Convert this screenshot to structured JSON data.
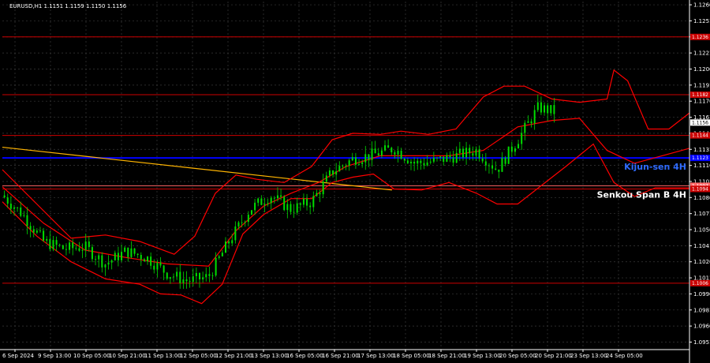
{
  "chart_data": {
    "type": "candlestick",
    "symbol_header": "EURUSD,H1  1.1151 1.1159 1.1150 1.1156",
    "x_labels": [
      "6 Sep 2024",
      "9 Sep 13:00",
      "10 Sep 05:00",
      "10 Sep 21:00",
      "11 Sep 13:00",
      "12 Sep 05:00",
      "12 Sep 21:00",
      "13 Sep 13:00",
      "16 Sep 05:00",
      "16 Sep 21:00",
      "17 Sep 13:00",
      "18 Sep 05:00",
      "18 Sep 21:00",
      "19 Sep 13:00",
      "20 Sep 05:00",
      "20 Sep 21:00",
      "23 Sep 13:00",
      "24 Sep 05:00"
    ],
    "y_ticks": [
      1.1266,
      1.1251,
      1.1236,
      1.1221,
      1.1206,
      1.1191,
      1.1176,
      1.1161,
      1.1146,
      1.1131,
      1.1116,
      1.1101,
      1.1086,
      1.1071,
      1.1056,
      1.1041,
      1.1026,
      1.1011,
      1.0996,
      1.0981,
      1.0966,
      1.0951
    ],
    "ylim": [
      1.0944,
      1.1269
    ],
    "grid": true,
    "colors": {
      "background": "#000000",
      "grid": "#3a3a3a",
      "candle": "#00dd00",
      "bollinger": "#ff0000",
      "kijun": "#0000ff",
      "senkou": "#ff6666",
      "trend": "#ffb400",
      "price_tag": "#ffffff"
    },
    "current_price": "1.1156",
    "levels": [
      {
        "price": 1.1236,
        "label": "1.1236",
        "color": "#cc0000"
      },
      {
        "price": 1.1182,
        "label": "1.1182",
        "color": "#cc0000"
      },
      {
        "price": 1.1144,
        "label": "1.1144",
        "color": "#cc0000"
      },
      {
        "price": 1.1123,
        "label": "1.1123",
        "color": "#0000ff",
        "annotation": "Kijun-sen 4H",
        "annotation_color": "#2f6bff"
      },
      {
        "price": 1.1097,
        "label": "1.1097",
        "color": "#ff6666",
        "annotation": "Senkou Span B 4H",
        "annotation_color": "#ffffff"
      },
      {
        "price": 1.1094,
        "label": "1.1094",
        "color": "#cc0000"
      },
      {
        "price": 1.1006,
        "label": "1.1006",
        "color": "#cc0000"
      }
    ],
    "trend_line": {
      "x": [
        0,
        0.567
      ],
      "y": [
        1.1133,
        1.1093
      ]
    },
    "x_range": [
      0,
      1
    ],
    "series": [
      {
        "name": "price",
        "x": [
          0,
          0.03,
          0.06,
          0.09,
          0.12,
          0.15,
          0.18,
          0.21,
          0.24,
          0.27,
          0.3,
          0.33,
          0.36,
          0.39,
          0.42,
          0.45,
          0.48,
          0.51,
          0.54,
          0.57,
          0.6,
          0.63,
          0.66,
          0.69,
          0.72,
          0.75,
          0.78,
          0.81,
          0.84,
          0.87,
          0.9,
          0.93,
          0.96,
          1.0
        ],
        "y": [
          1.1088,
          1.107,
          1.1045,
          1.1038,
          1.104,
          1.1024,
          1.1036,
          1.103,
          1.1015,
          1.1008,
          1.1012,
          1.1045,
          1.1075,
          1.1088,
          1.1075,
          1.1082,
          1.111,
          1.1122,
          1.1126,
          1.1132,
          1.1118,
          1.112,
          1.1125,
          1.113,
          1.1112,
          1.114,
          1.117,
          1.1165,
          1.1168,
          1.116,
          1.111,
          1.1115,
          1.113,
          1.1155
        ]
      },
      {
        "name": "bb_upper",
        "x": [
          0,
          0.05,
          0.1,
          0.15,
          0.2,
          0.25,
          0.28,
          0.31,
          0.34,
          0.37,
          0.41,
          0.45,
          0.48,
          0.51,
          0.55,
          0.58,
          0.62,
          0.66,
          0.7,
          0.73,
          0.76,
          0.8,
          0.84,
          0.88,
          0.89,
          0.91,
          0.94,
          0.97,
          1.0
        ],
        "y": [
          1.1112,
          1.108,
          1.1048,
          1.1051,
          1.1045,
          1.1033,
          1.105,
          1.109,
          1.1107,
          1.1103,
          1.11,
          1.1115,
          1.114,
          1.1146,
          1.1145,
          1.1148,
          1.1145,
          1.115,
          1.118,
          1.119,
          1.119,
          1.1178,
          1.1175,
          1.1178,
          1.1205,
          1.1195,
          1.115,
          1.115,
          1.1165
        ]
      },
      {
        "name": "bb_lower",
        "x": [
          0,
          0.05,
          0.1,
          0.15,
          0.2,
          0.23,
          0.26,
          0.29,
          0.32,
          0.35,
          0.38,
          0.42,
          0.45,
          0.48,
          0.51,
          0.54,
          0.57,
          0.61,
          0.65,
          0.69,
          0.72,
          0.75,
          0.78,
          0.82,
          0.86,
          0.89,
          0.92,
          0.95,
          1.0
        ],
        "y": [
          1.1082,
          1.105,
          1.1026,
          1.101,
          1.1005,
          1.0996,
          1.0995,
          1.0987,
          1.1005,
          1.1052,
          1.107,
          1.1085,
          1.1085,
          1.11,
          1.1105,
          1.1108,
          1.1094,
          1.1093,
          1.11,
          1.109,
          1.108,
          1.108,
          1.1095,
          1.1115,
          1.1136,
          1.11,
          1.1087,
          1.1095,
          1.1095
        ]
      },
      {
        "name": "bb_middle",
        "x": [
          0,
          0.06,
          0.12,
          0.18,
          0.24,
          0.3,
          0.34,
          0.38,
          0.42,
          0.46,
          0.5,
          0.55,
          0.6,
          0.65,
          0.7,
          0.75,
          0.8,
          0.84,
          0.88,
          0.92,
          0.96,
          1.0
        ],
        "y": [
          1.1096,
          1.1062,
          1.1037,
          1.103,
          1.1024,
          1.1022,
          1.1055,
          1.1078,
          1.109,
          1.11,
          1.1115,
          1.1125,
          1.1125,
          1.1125,
          1.113,
          1.1152,
          1.1158,
          1.116,
          1.113,
          1.1118,
          1.1125,
          1.1132
        ]
      }
    ]
  }
}
